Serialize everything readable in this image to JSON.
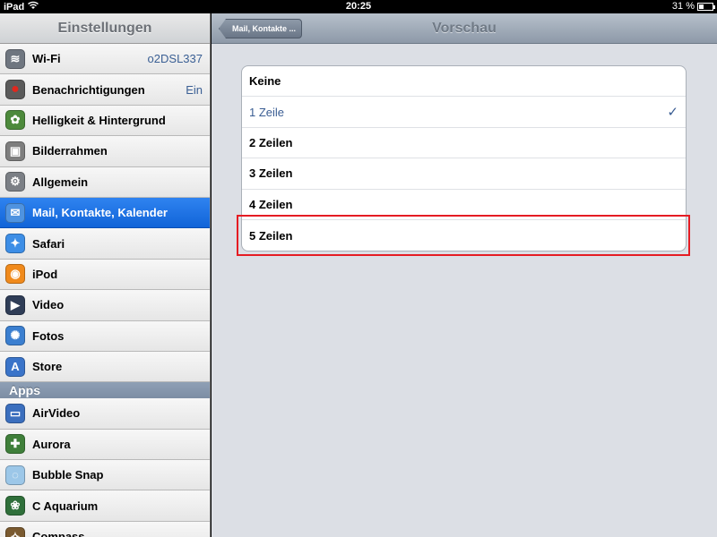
{
  "status_bar": {
    "device": "iPad",
    "time": "20:25",
    "battery": "31 %"
  },
  "sidebar": {
    "title": "Einstellungen",
    "items": [
      {
        "label": "Wi-Fi",
        "value": "o2DSL337",
        "icon": "wifi-icon",
        "color": "#6f7680"
      },
      {
        "label": "Benachrichtigungen",
        "value": "Ein",
        "icon": "notifications-icon",
        "color": "#5b5b5b"
      },
      {
        "label": "Helligkeit & Hintergrund",
        "value": "",
        "icon": "brightness-icon",
        "color": "#4d8a3c"
      },
      {
        "label": "Bilderrahmen",
        "value": "",
        "icon": "picture-frame-icon",
        "color": "#7e7e7e"
      },
      {
        "label": "Allgemein",
        "value": "",
        "icon": "gear-icon",
        "color": "#7b7f85"
      },
      {
        "label": "Mail, Kontakte, Kalender",
        "value": "",
        "icon": "mail-icon",
        "color": "#4f93e0",
        "selected": true
      },
      {
        "label": "Safari",
        "value": "",
        "icon": "safari-compass-icon",
        "color": "#3d8ee6"
      },
      {
        "label": "iPod",
        "value": "",
        "icon": "ipod-icon",
        "color": "#f08a1c"
      },
      {
        "label": "Video",
        "value": "",
        "icon": "clapperboard-icon",
        "color": "#2f3d57"
      },
      {
        "label": "Fotos",
        "value": "",
        "icon": "sunflower-icon",
        "color": "#3b7fd0"
      },
      {
        "label": "Store",
        "value": "",
        "icon": "app-store-icon",
        "color": "#3a74c9"
      }
    ],
    "apps_header": "Apps",
    "apps": [
      {
        "label": "AirVideo",
        "icon": "airvideo-icon",
        "color": "#3b6fbe"
      },
      {
        "label": "Aurora",
        "icon": "aurora-icon",
        "color": "#3f7f3a"
      },
      {
        "label": "Bubble Snap",
        "icon": "bubble-snap-icon",
        "color": "#9cc7e8"
      },
      {
        "label": "C Aquarium",
        "icon": "aquarium-icon",
        "color": "#2f6f3a"
      },
      {
        "label": "Compass",
        "icon": "compass-icon",
        "color": "#7a5a30"
      }
    ]
  },
  "detail": {
    "back_label": "Mail, Kontakte ...",
    "title": "Vorschau",
    "options": [
      {
        "label": "Keine",
        "checked": false
      },
      {
        "label": "1 Zeile",
        "checked": true
      },
      {
        "label": "2 Zeilen",
        "checked": false
      },
      {
        "label": "3 Zeilen",
        "checked": false
      },
      {
        "label": "4 Zeilen",
        "checked": false
      },
      {
        "label": "5 Zeilen",
        "checked": false
      }
    ],
    "check_mark": "✓"
  },
  "colors": {
    "highlight": "#e51c23",
    "selected": "#1a6ee0"
  }
}
